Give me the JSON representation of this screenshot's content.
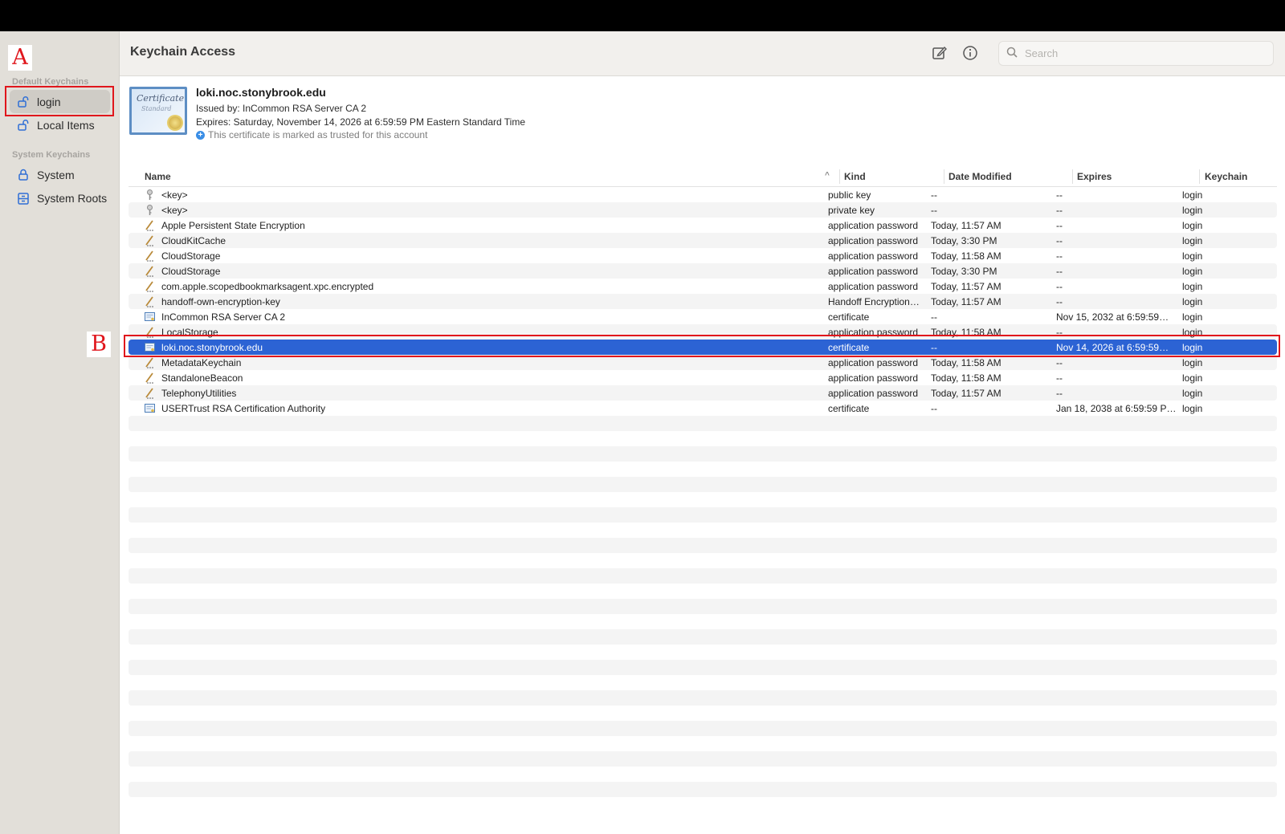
{
  "window": {
    "title": "Keychain Access"
  },
  "sidebar": {
    "sections": [
      {
        "label": "Default Keychains"
      },
      {
        "label": "System Keychains"
      }
    ],
    "items": [
      {
        "label": "login",
        "icon": "lock-open-icon"
      },
      {
        "label": "Local Items",
        "icon": "lock-open-icon"
      },
      {
        "label": "System",
        "icon": "lock-icon"
      },
      {
        "label": "System Roots",
        "icon": "cabinet-icon"
      }
    ]
  },
  "toolbar": {
    "compose_icon": "compose-icon",
    "info_icon": "info-icon",
    "search_placeholder": "Search"
  },
  "certificate": {
    "name": "loki.noc.stonybrook.edu",
    "issued_by": "Issued by: InCommon RSA Server CA 2",
    "expires": "Expires: Saturday, November 14, 2026 at 6:59:59 PM Eastern Standard Time",
    "trust": "This certificate is marked as trusted for this account",
    "image_text": "Certificate",
    "image_subtext": "Standard"
  },
  "table": {
    "columns": [
      "Name",
      "Kind",
      "Date Modified",
      "Expires",
      "Keychain"
    ],
    "sort_indicator": "^",
    "rows": [
      {
        "icon": "key-icon",
        "name": "<key>",
        "kind": "public key",
        "modified": "--",
        "expires": "--",
        "keychain": "login"
      },
      {
        "icon": "key-icon",
        "name": "<key>",
        "kind": "private key",
        "modified": "--",
        "expires": "--",
        "keychain": "login"
      },
      {
        "icon": "password-icon",
        "name": "Apple Persistent State Encryption",
        "kind": "application password",
        "modified": "Today, 11:57 AM",
        "expires": "--",
        "keychain": "login"
      },
      {
        "icon": "password-icon",
        "name": "CloudKitCache",
        "kind": "application password",
        "modified": "Today, 3:30 PM",
        "expires": "--",
        "keychain": "login"
      },
      {
        "icon": "password-icon",
        "name": "CloudStorage",
        "kind": "application password",
        "modified": "Today, 11:58 AM",
        "expires": "--",
        "keychain": "login"
      },
      {
        "icon": "password-icon",
        "name": "CloudStorage",
        "kind": "application password",
        "modified": "Today, 3:30 PM",
        "expires": "--",
        "keychain": "login"
      },
      {
        "icon": "password-icon",
        "name": "com.apple.scopedbookmarksagent.xpc.encrypted",
        "kind": "application password",
        "modified": "Today, 11:57 AM",
        "expires": "--",
        "keychain": "login"
      },
      {
        "icon": "password-icon",
        "name": "handoff-own-encryption-key",
        "kind": "Handoff Encryption…",
        "modified": "Today, 11:57 AM",
        "expires": "--",
        "keychain": "login"
      },
      {
        "icon": "certificate-icon",
        "name": "InCommon RSA Server CA 2",
        "kind": "certificate",
        "modified": "--",
        "expires": "Nov 15, 2032 at 6:59:59…",
        "keychain": "login"
      },
      {
        "icon": "password-icon",
        "name": "LocalStorage",
        "kind": "application password",
        "modified": "Today, 11:58 AM",
        "expires": "--",
        "keychain": "login"
      },
      {
        "icon": "certificate-icon",
        "name": "loki.noc.stonybrook.edu",
        "kind": "certificate",
        "modified": "--",
        "expires": "Nov 14, 2026 at 6:59:59…",
        "keychain": "login",
        "selected": true
      },
      {
        "icon": "password-icon",
        "name": "MetadataKeychain",
        "kind": "application password",
        "modified": "Today, 11:58 AM",
        "expires": "--",
        "keychain": "login"
      },
      {
        "icon": "password-icon",
        "name": "StandaloneBeacon",
        "kind": "application password",
        "modified": "Today, 11:58 AM",
        "expires": "--",
        "keychain": "login"
      },
      {
        "icon": "password-icon",
        "name": "TelephonyUtilities",
        "kind": "application password",
        "modified": "Today, 11:57 AM",
        "expires": "--",
        "keychain": "login"
      },
      {
        "icon": "certificate-icon",
        "name": "USERTrust RSA Certification Authority",
        "kind": "certificate",
        "modified": "--",
        "expires": "Jan 18, 2038 at 6:59:59 P…",
        "keychain": "login"
      }
    ]
  },
  "annotations": {
    "a": "A",
    "b": "B"
  },
  "colors": {
    "selection": "#2c63d4",
    "annotation": "#e0161c"
  }
}
